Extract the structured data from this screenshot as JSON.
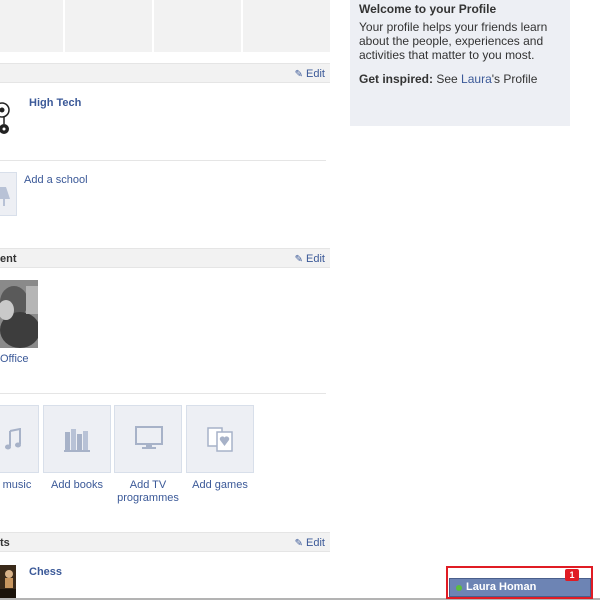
{
  "work_section": {
    "edit_label": "Edit",
    "employer": "High Tech",
    "add_school": "Add a school"
  },
  "entertainment_section": {
    "header_label": "ent",
    "edit_label": "Edit",
    "tv_item": "Office",
    "add_tiles": [
      {
        "label": "music",
        "icon": "music-note-icon"
      },
      {
        "label": "Add books",
        "icon": "books-icon"
      },
      {
        "label": "Add TV\nprogrammes",
        "icon": "tv-icon"
      },
      {
        "label": "Add games",
        "icon": "cards-icon"
      }
    ]
  },
  "activities_section": {
    "header_label": "ts",
    "edit_label": "Edit",
    "item": "Chess"
  },
  "welcome": {
    "title": "Welcome to your Profile",
    "body": "Your profile helps your friends learn about the people, experiences and activities that matter to you most.",
    "inspire_label": "Get inspired:",
    "inspire_see": " See ",
    "inspire_name": "Laura",
    "inspire_suffix": "'s Profile"
  },
  "chat": {
    "name": "Laura Homan",
    "badge": "1",
    "status_color": "#5bbf3a"
  }
}
